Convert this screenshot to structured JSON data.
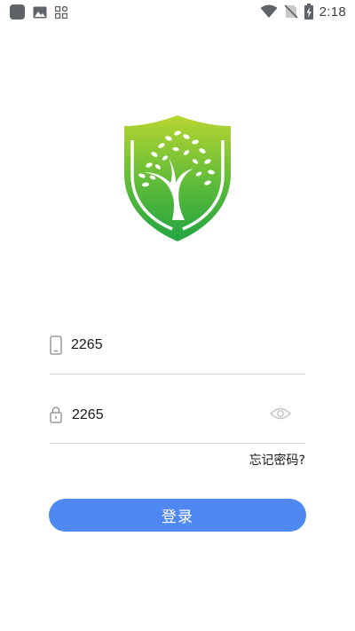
{
  "status_bar": {
    "time": "2:18",
    "left_icons": [
      "app-square-icon",
      "image-icon",
      "grid-icon"
    ],
    "right_icons": [
      "wifi-icon",
      "no-sim-icon",
      "battery-charging-icon"
    ]
  },
  "logo": {
    "icon": "shield-tree-logo",
    "colors": [
      "#b5d334",
      "#2fab3f",
      "#ffffff"
    ]
  },
  "form": {
    "phone": {
      "icon": "phone-icon",
      "value": "2265"
    },
    "password": {
      "icon": "lock-icon",
      "value": "2265",
      "toggle_icon": "eye-icon"
    },
    "forgot_label": "忘记密码?",
    "login_label": "登录"
  },
  "colors": {
    "primary": "#5088f2",
    "divider": "#d8d8d8",
    "logo_green": "#3bb44a",
    "logo_lime": "#b5d334"
  }
}
